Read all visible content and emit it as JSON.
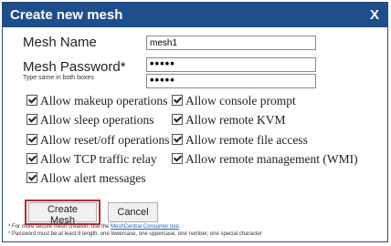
{
  "dialog": {
    "title": "Create new mesh",
    "close_label": "X"
  },
  "form": {
    "mesh_name_label": "Mesh Name",
    "mesh_name_value": "mesh1",
    "mesh_password_label": "Mesh Password*",
    "password_hint": "Type same in both boxes",
    "password_value": "•••••",
    "password_confirm_value": "•••••"
  },
  "options": [
    {
      "label": "Allow makeup operations",
      "checked": true
    },
    {
      "label": "Allow console prompt",
      "checked": true
    },
    {
      "label": "Allow sleep operations",
      "checked": true
    },
    {
      "label": "Allow remote KVM",
      "checked": true
    },
    {
      "label": "Allow reset/off operations",
      "checked": true
    },
    {
      "label": "Allow remote file access",
      "checked": true
    },
    {
      "label": "Allow TCP traffic relay",
      "checked": true
    },
    {
      "label": "Allow remote management (WMI)",
      "checked": true
    },
    {
      "label": "Allow alert messages",
      "checked": true
    }
  ],
  "buttons": {
    "create": "Create Mesh",
    "cancel": "Cancel"
  },
  "notes": {
    "line1_prefix": "* For more secure mesh creation, use the ",
    "line1_link": "MeshCentral Consumer tool",
    "line1_suffix": ".",
    "line2": "* Password must be at least 8 length, one lowercase, one uppercase, one number, one special character"
  },
  "colors": {
    "titlebar": "#1f4e8c",
    "highlight": "#c0282e",
    "link": "#1a5fb4"
  }
}
